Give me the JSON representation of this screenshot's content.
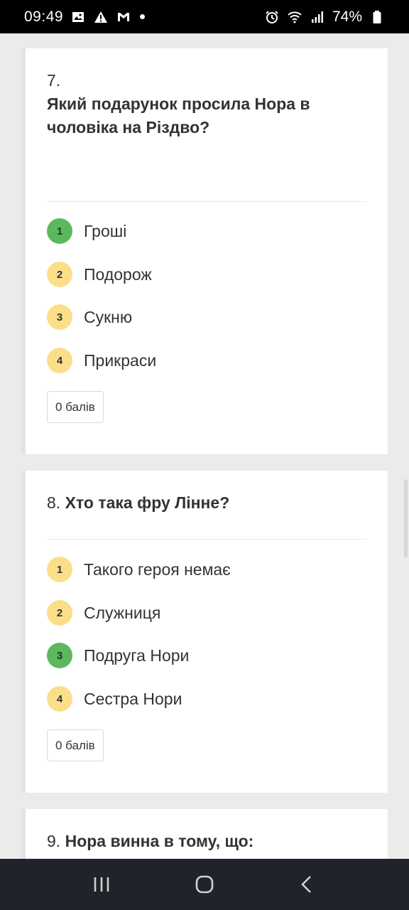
{
  "status_bar": {
    "time": "09:49",
    "left_icons": [
      "gallery-icon",
      "alert-icon",
      "gmail-icon",
      "dot-icon"
    ],
    "right_icons": [
      "alarm-icon",
      "wifi-icon",
      "signal-icon",
      "battery-icon"
    ],
    "battery": "74%"
  },
  "questions": [
    {
      "number": "7.",
      "text": "Який подарунок просила Нора в чоловіка на Різдво?",
      "options": [
        {
          "num": "1",
          "label": "Гроші",
          "correct": true
        },
        {
          "num": "2",
          "label": "Подорож",
          "correct": false
        },
        {
          "num": "3",
          "label": "Сукню",
          "correct": false
        },
        {
          "num": "4",
          "label": "Прикраси",
          "correct": false
        }
      ],
      "score": "0 балів"
    },
    {
      "number": "8.",
      "text": "Хто така фру Лінне?",
      "options": [
        {
          "num": "1",
          "label": "Такого героя немає",
          "correct": false
        },
        {
          "num": "2",
          "label": "Служниця",
          "correct": false
        },
        {
          "num": "3",
          "label": "Подруга Нори",
          "correct": true
        },
        {
          "num": "4",
          "label": "Сестра Нори",
          "correct": false
        }
      ],
      "score": "0 балів"
    },
    {
      "number": "9.",
      "text": "Нора винна в тому, що:"
    }
  ],
  "colors": {
    "correct": "#5cb85c",
    "option": "#fbdf88",
    "background": "#ebebeb"
  },
  "nav_bar": {
    "icons": [
      "recents-icon",
      "home-icon",
      "back-icon"
    ]
  }
}
